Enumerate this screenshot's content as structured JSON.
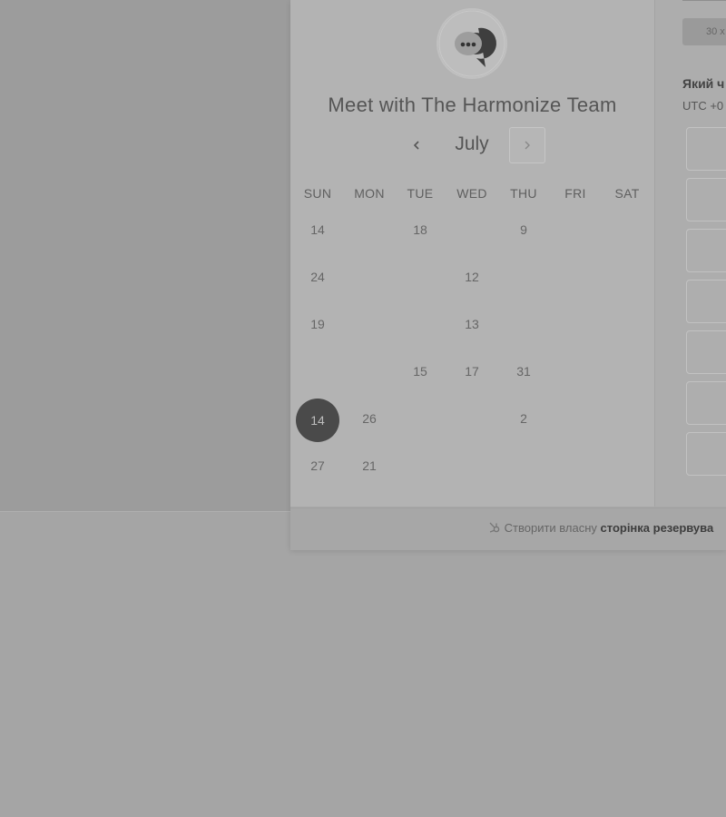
{
  "calendar": {
    "title": "Meet with The Harmonize Team",
    "month": "July",
    "weekdays": [
      "SUN",
      "MON",
      "TUE",
      "WED",
      "THU",
      "FRI",
      "SAT"
    ],
    "weeks": [
      [
        "14",
        "",
        "18",
        "",
        "9",
        "",
        ""
      ],
      [
        "24",
        "",
        "",
        "12",
        "",
        "",
        ""
      ],
      [
        "19",
        "",
        "",
        "13",
        "",
        "",
        ""
      ],
      [
        "",
        "",
        "15",
        "17",
        "31",
        "",
        ""
      ],
      [
        "14",
        "26",
        "",
        "",
        "2",
        "",
        ""
      ],
      [
        "27",
        "21",
        "",
        "",
        "",
        "",
        ""
      ]
    ],
    "selected": {
      "week": 4,
      "day": 0
    }
  },
  "right_panel": {
    "duration_label": "30 х",
    "question": "Який ч",
    "timezone": "UTC +0"
  },
  "footer": {
    "prefix": "Створити власну",
    "bold": "сторінка резервува"
  }
}
